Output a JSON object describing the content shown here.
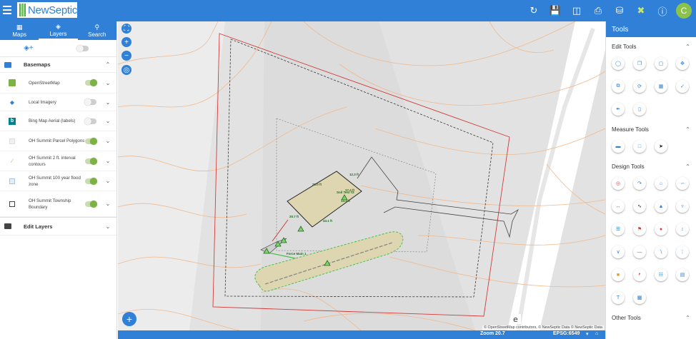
{
  "app": {
    "logo_text": "NewSeptic",
    "user_initial": "C"
  },
  "toolbar": {
    "icons": [
      "refresh-icon",
      "save-icon",
      "layers-stack-icon",
      "print-icon",
      "save-as-icon",
      "tools-icon",
      "info-icon"
    ]
  },
  "left_tabs": [
    {
      "label": "Maps",
      "icon": "map-icon"
    },
    {
      "label": "Layers",
      "icon": "layers-icon",
      "active": true
    },
    {
      "label": "Search",
      "icon": "search-icon"
    }
  ],
  "left_panel": {
    "basemaps_title": "Basemaps",
    "edit_layers_title": "Edit Layers",
    "layers": [
      {
        "name": "OpenStreetMap",
        "on": true
      },
      {
        "name": "Local Imagery",
        "on": false
      },
      {
        "name": "Bing Map Aerial (labels)",
        "on": false
      },
      {
        "name": "OH Summit Parcel Polygons",
        "on": true
      },
      {
        "name": "OH Summit 2 ft. interval contours",
        "on": true
      },
      {
        "name": "OH Summit 100 year flood zone",
        "on": true
      },
      {
        "name": "OH Summit Township Boundary",
        "on": true
      }
    ]
  },
  "map": {
    "labels": [
      "20.0 ft",
      "12.3 ft",
      "Soil Test #2",
      "17.4 ft",
      "13.3 ft",
      "20.7 ft",
      "43.1 ft",
      "Force Main 1"
    ],
    "attribution": "© OpenStreetMap contributors, © NewSeptic Data © NewSeptic Data"
  },
  "status": {
    "zoom_text": "Zoom  20.7",
    "epsg_text": "EPSG:6549"
  },
  "right_panel": {
    "title": "Tools",
    "sections": [
      "Edit Tools",
      "Measure Tools",
      "Design Tools",
      "Other Tools"
    ]
  }
}
